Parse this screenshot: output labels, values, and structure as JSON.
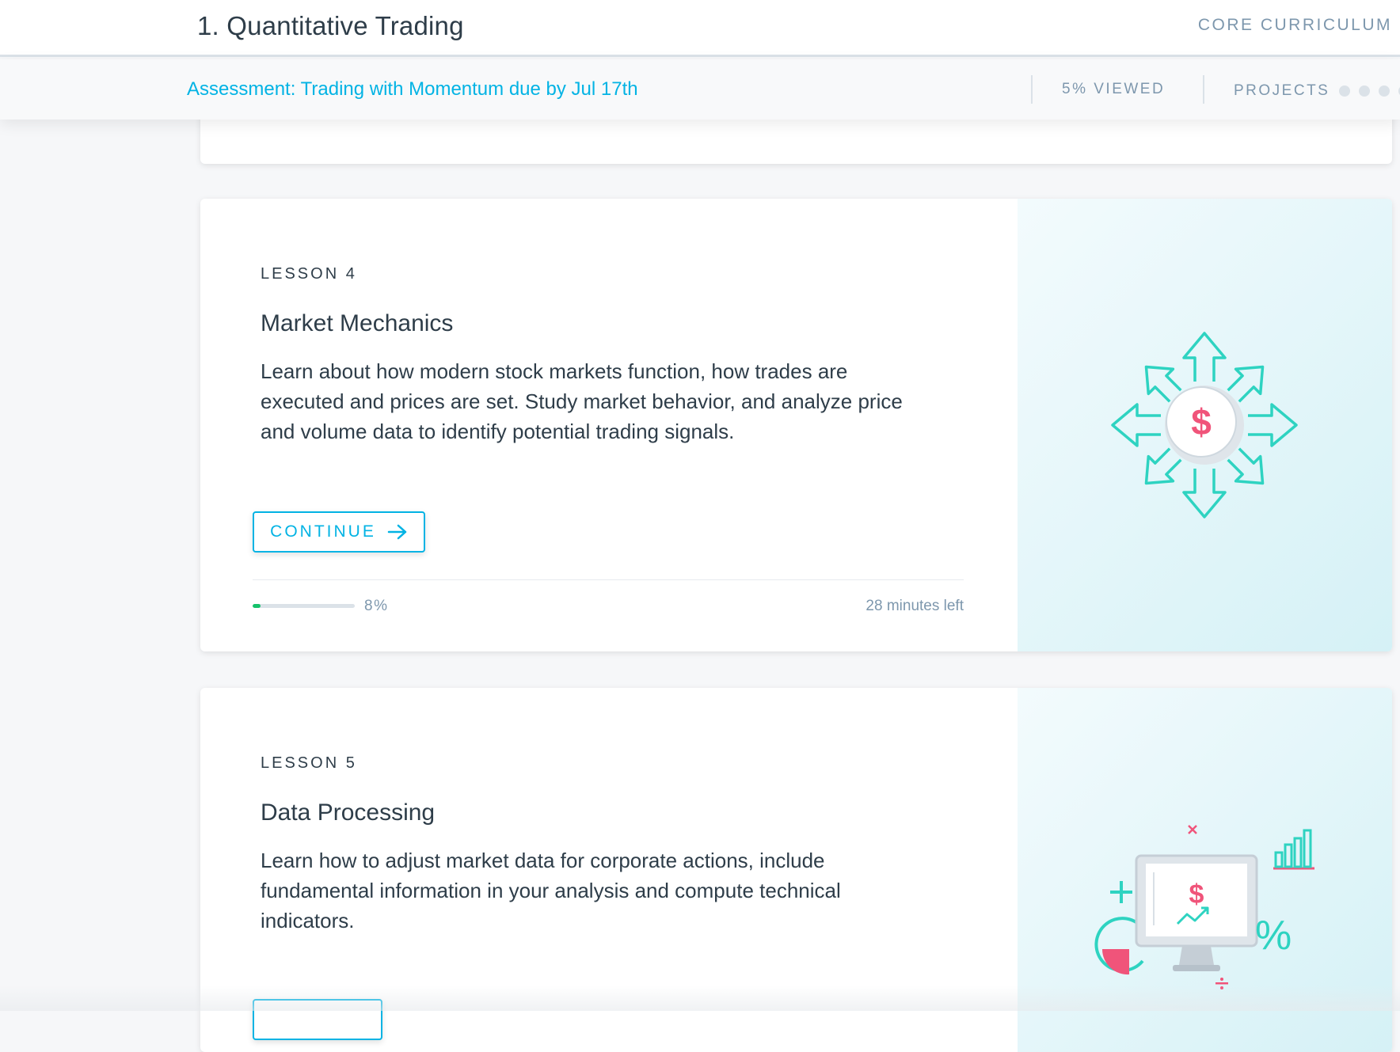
{
  "header": {
    "course_title": "1. Quantitative Trading",
    "curriculum_label": "CORE CURRICULUM"
  },
  "subheader": {
    "assessment_link": "Assessment: Trading with Momentum due by Jul 17th",
    "viewed": "5% VIEWED",
    "projects_label": "PROJECTS",
    "projects_dots": 4
  },
  "lessons": [
    {
      "label": "LESSON 4",
      "title": "Market Mechanics",
      "description": "Learn about how modern stock markets function, how trades are executed and prices are set. Study market behavior, and analyze price and volume data to identify potential trading signals.",
      "button_label": "CONTINUE",
      "progress": 0.08,
      "progress_text": "8%",
      "time_left": "28 minutes left",
      "icon": "dollar-arrows-icon"
    },
    {
      "label": "LESSON 5",
      "title": "Data Processing",
      "description": "Learn how to adjust market data for corporate actions, include fundamental information in your analysis and compute technical indicators.",
      "icon": "monitor-chart-icon"
    }
  ],
  "colors": {
    "accent": "#02b3e4",
    "teal": "#2ed3c1",
    "pink": "#f0547a",
    "progress": "#15c26b",
    "muted": "#7d97ad"
  }
}
